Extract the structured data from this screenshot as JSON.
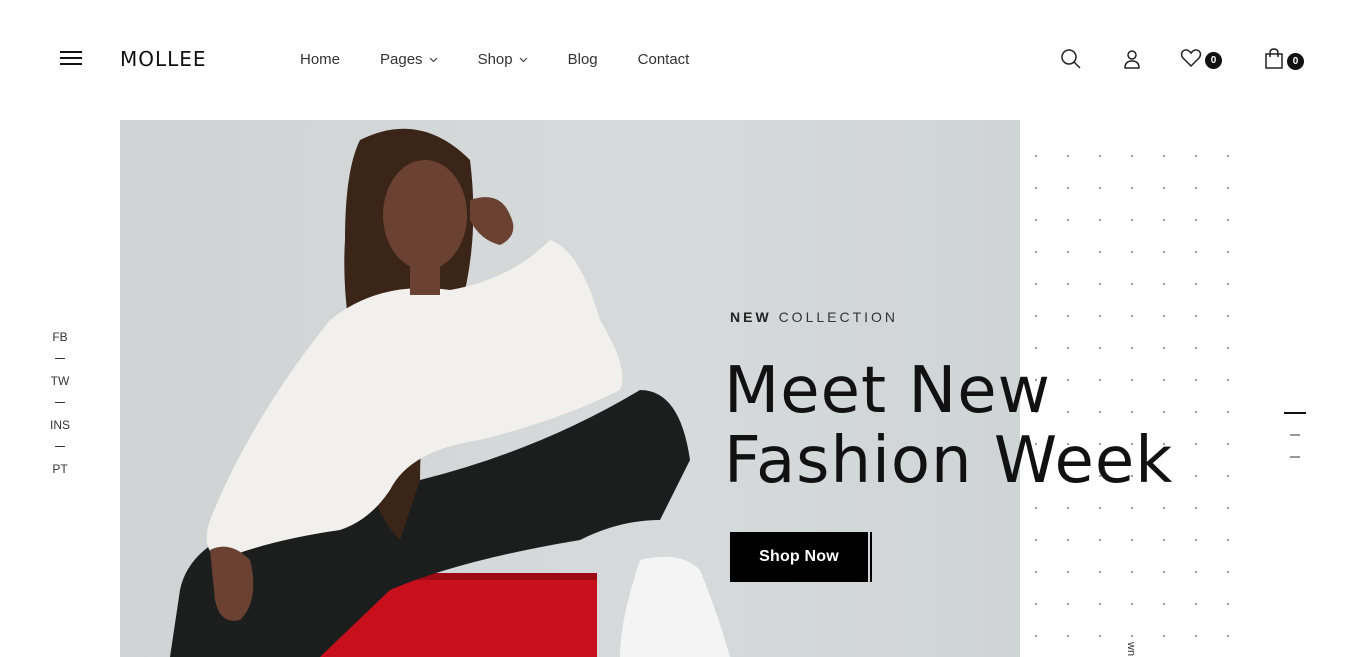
{
  "brand": {
    "logo_text": "MOLLEE"
  },
  "nav": [
    {
      "label": "Home",
      "has_dropdown": false
    },
    {
      "label": "Pages",
      "has_dropdown": true
    },
    {
      "label": "Shop",
      "has_dropdown": true
    },
    {
      "label": "Blog",
      "has_dropdown": false
    },
    {
      "label": "Contact",
      "has_dropdown": false
    }
  ],
  "header_icons": {
    "search": "search-icon",
    "account": "user-icon",
    "wishlist": {
      "icon": "heart-icon",
      "count": "0"
    },
    "cart": {
      "icon": "shopping-bag-icon",
      "count": "0"
    }
  },
  "social": [
    "FB",
    "TW",
    "INS",
    "PT"
  ],
  "hero": {
    "eyebrow_bold": "NEW",
    "eyebrow_rest": "COLLECTION",
    "headline_line1": "Meet New",
    "headline_line2": "Fashion Week",
    "cta_label": "Shop Now",
    "slides_total": 3,
    "active_slide": 1
  },
  "scroll_hint": "wn",
  "colors": {
    "primary": "#000000",
    "hero_bg": "#d3d7d8",
    "accent_red": "#c8101c"
  }
}
